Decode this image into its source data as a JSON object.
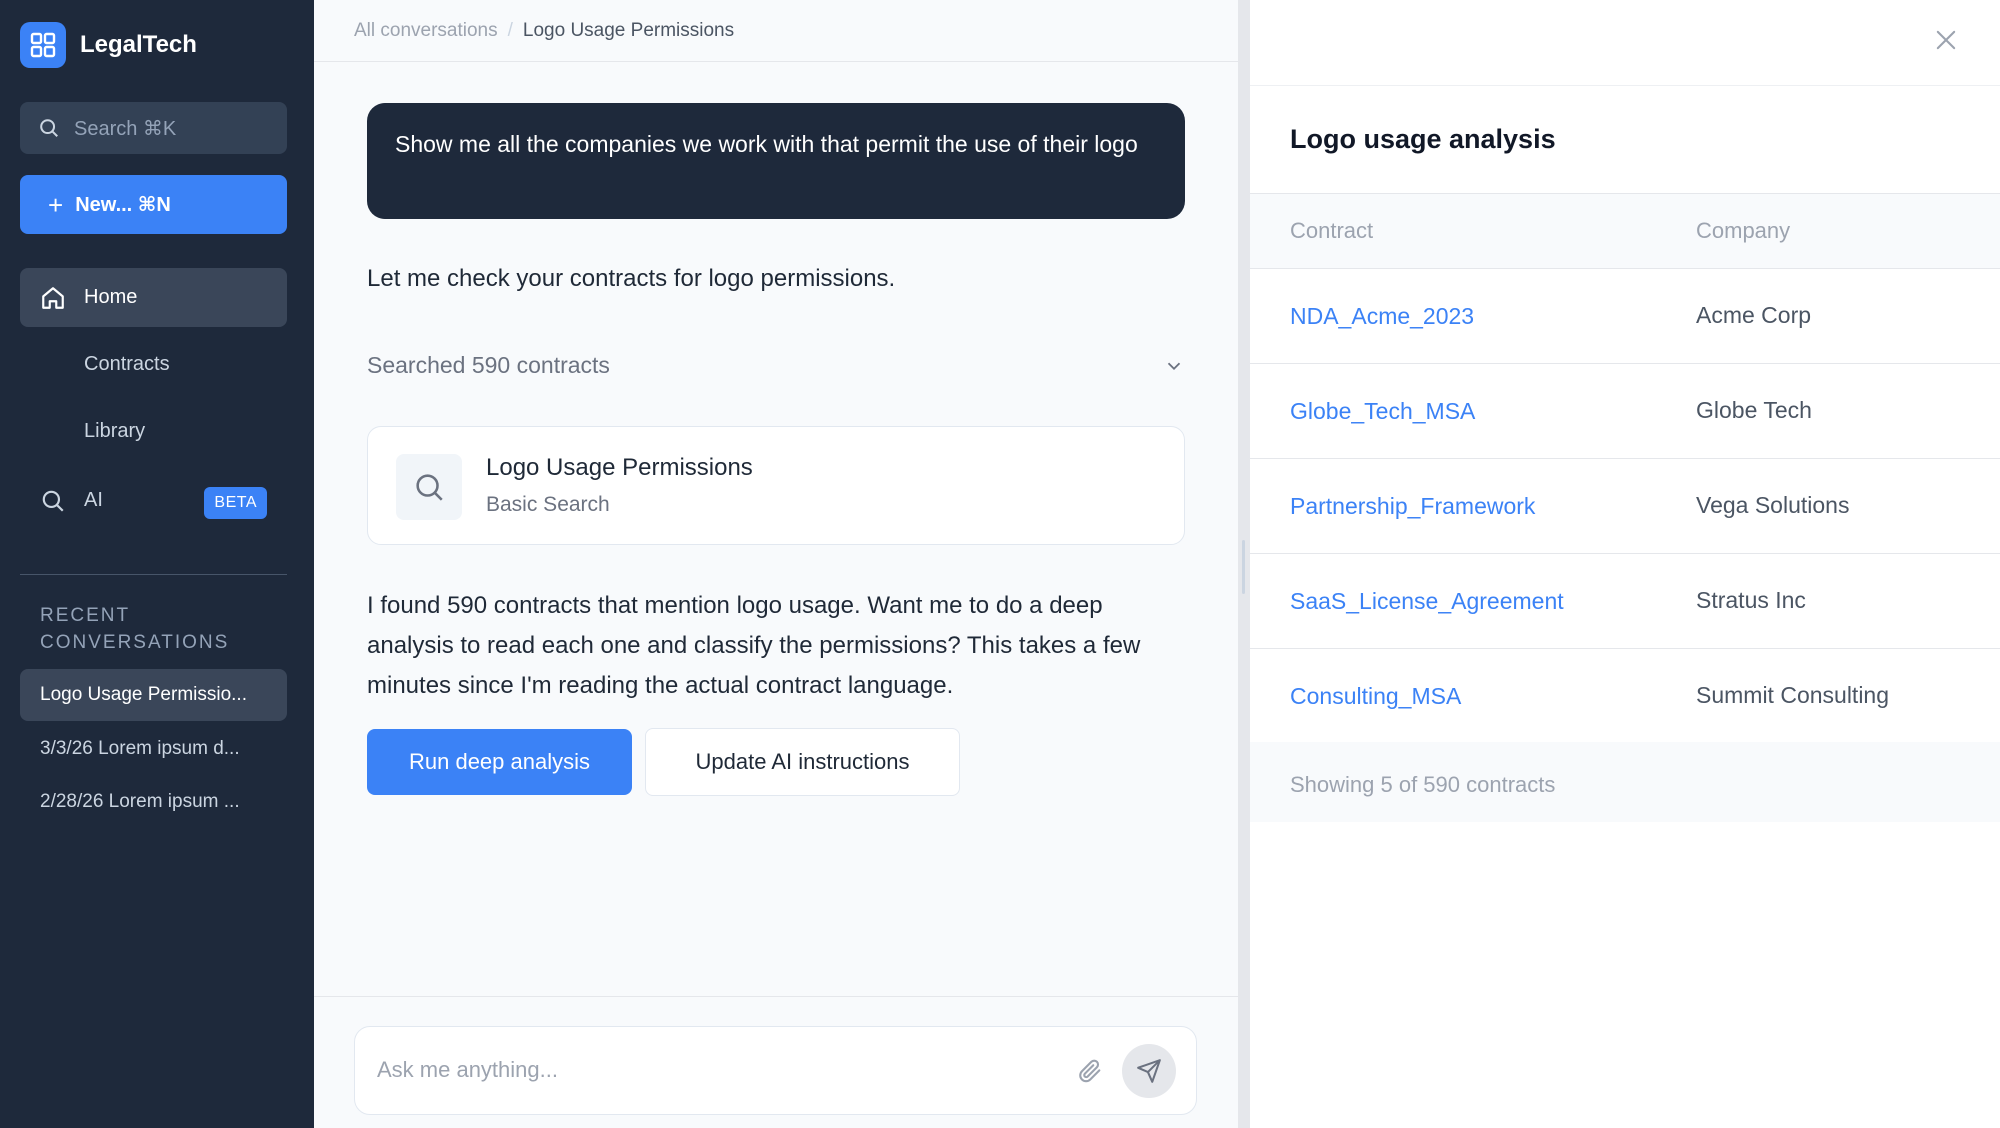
{
  "app": {
    "name": "LegalTech"
  },
  "sidebar": {
    "search_label": "Search ⌘K",
    "new_label": "New... ⌘N",
    "nav": [
      {
        "label": "Home"
      },
      {
        "label": "Contracts"
      },
      {
        "label": "Library"
      },
      {
        "label": "AI",
        "badge": "BETA"
      }
    ],
    "recent_title": "Recent conversations",
    "conversations": [
      {
        "label": "Logo Usage Permissio..."
      },
      {
        "label": "3/3/26 Lorem ipsum d..."
      },
      {
        "label": "2/28/26 Lorem ipsum ..."
      }
    ]
  },
  "breadcrumb": {
    "root": "All conversations",
    "separator": "/",
    "current": "Logo Usage Permissions"
  },
  "chat": {
    "user_message": "Show me all the companies we work with that permit the use of their logo",
    "ai_intro": "Let me check your contracts for logo permissions.",
    "searched_label": "Searched 590 contracts",
    "search_card": {
      "title": "Logo Usage Permissions",
      "subtitle": "Basic Search"
    },
    "ai_result": "I found 590 contracts that mention logo usage. Want me to do a deep analysis to read each one and classify the permissions? This takes a few minutes since I'm reading the actual contract language.",
    "primary_action": "Run deep analysis",
    "secondary_action": "Update AI instructions"
  },
  "composer": {
    "placeholder": "Ask me anything..."
  },
  "panel": {
    "title": "Logo usage analysis",
    "columns": [
      "Contract",
      "Company"
    ],
    "rows": [
      {
        "contract": "NDA_Acme_2023",
        "company": "Acme Corp"
      },
      {
        "contract": "Globe_Tech_MSA",
        "company": "Globe Tech"
      },
      {
        "contract": "Partnership_Framework",
        "company": "Vega Solutions"
      },
      {
        "contract": "SaaS_License_Agreement",
        "company": "Stratus Inc"
      },
      {
        "contract": "Consulting_MSA",
        "company": "Summit Consulting"
      }
    ],
    "footer": "Showing 5 of 590 contracts"
  },
  "colors": {
    "sidebar_bg": "#1e293b",
    "accent": "#3b82f6",
    "bubble_bg": "#1e293b"
  },
  "icons": [
    "grid-logo-icon",
    "search-icon",
    "plus-icon",
    "home-icon",
    "chevron-down-icon",
    "attach-icon",
    "send-icon",
    "close-icon"
  ]
}
